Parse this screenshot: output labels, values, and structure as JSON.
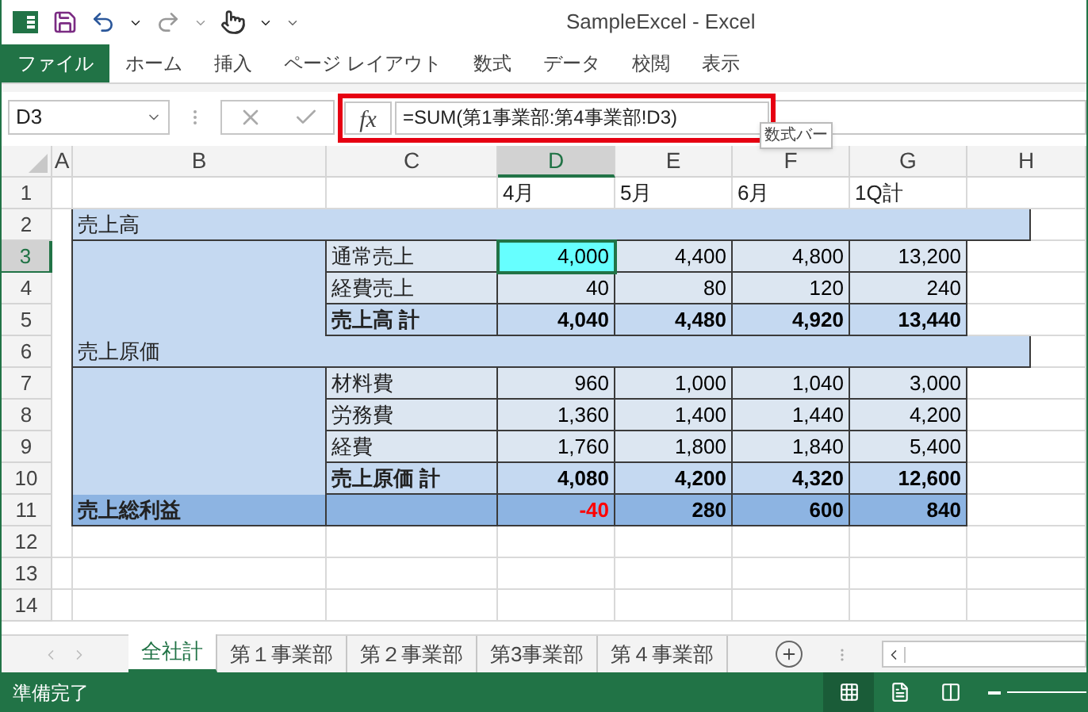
{
  "window": {
    "title": "SampleExcel - Excel"
  },
  "ribbon_tabs": [
    {
      "label": "ファイル",
      "kind": "file"
    },
    {
      "label": "ホーム",
      "kind": "tab"
    },
    {
      "label": "挿入",
      "kind": "tab"
    },
    {
      "label": "ページ レイアウト",
      "kind": "tab"
    },
    {
      "label": "数式",
      "kind": "tab"
    },
    {
      "label": "データ",
      "kind": "tab"
    },
    {
      "label": "校閲",
      "kind": "tab"
    },
    {
      "label": "表示",
      "kind": "tab"
    }
  ],
  "formula_bar": {
    "name_box": "D3",
    "fx": "fx",
    "formula": "=SUM(第1事業部:第4事業部!D3)",
    "tooltip": "数式バー"
  },
  "columns": [
    {
      "label": "A",
      "selected": false
    },
    {
      "label": "B",
      "selected": false
    },
    {
      "label": "C",
      "selected": false
    },
    {
      "label": "D",
      "selected": true
    },
    {
      "label": "E",
      "selected": false
    },
    {
      "label": "F",
      "selected": false
    },
    {
      "label": "G",
      "selected": false
    },
    {
      "label": "H",
      "selected": false
    }
  ],
  "rows": [
    {
      "number": "1",
      "selected": false,
      "kind": "header",
      "values": [
        "4月",
        "5月",
        "6月",
        "1Q計"
      ]
    },
    {
      "number": "2",
      "selected": false,
      "kind": "section",
      "label": "売上高"
    },
    {
      "number": "3",
      "selected": true,
      "kind": "item",
      "label": "通常売上",
      "values": [
        "4,000",
        "4,400",
        "4,800",
        "13,200"
      ]
    },
    {
      "number": "4",
      "selected": false,
      "kind": "item",
      "label": "経費売上",
      "values": [
        "40",
        "80",
        "120",
        "240"
      ]
    },
    {
      "number": "5",
      "selected": false,
      "kind": "subtotal",
      "label": "売上高 計",
      "values": [
        "4,040",
        "4,480",
        "4,920",
        "13,440"
      ]
    },
    {
      "number": "6",
      "selected": false,
      "kind": "section",
      "label": "売上原価"
    },
    {
      "number": "7",
      "selected": false,
      "kind": "item",
      "label": "材料費",
      "values": [
        "960",
        "1,000",
        "1,040",
        "3,000"
      ]
    },
    {
      "number": "8",
      "selected": false,
      "kind": "item",
      "label": "労務費",
      "values": [
        "1,360",
        "1,400",
        "1,440",
        "4,200"
      ]
    },
    {
      "number": "9",
      "selected": false,
      "kind": "item",
      "label": "経費",
      "values": [
        "1,760",
        "1,800",
        "1,840",
        "5,400"
      ]
    },
    {
      "number": "10",
      "selected": false,
      "kind": "subtotal",
      "label": "売上原価 計",
      "values": [
        "4,080",
        "4,200",
        "4,320",
        "12,600"
      ]
    },
    {
      "number": "11",
      "selected": false,
      "kind": "total",
      "label": "売上総利益",
      "values": [
        {
          "text": "-40",
          "negative": true
        },
        {
          "text": "280",
          "negative": false
        },
        {
          "text": "600",
          "negative": false
        },
        {
          "text": "840",
          "negative": false
        }
      ]
    },
    {
      "number": "12",
      "selected": false,
      "kind": "empty"
    },
    {
      "number": "13",
      "selected": false,
      "kind": "empty"
    },
    {
      "number": "14",
      "selected": false,
      "kind": "empty"
    }
  ],
  "sheet_tabs": [
    {
      "label": "全社計",
      "selected": true
    },
    {
      "label": "第１事業部",
      "selected": false
    },
    {
      "label": "第２事業部",
      "selected": false
    },
    {
      "label": "第3事業部",
      "selected": false
    },
    {
      "label": "第４事業部",
      "selected": false
    }
  ],
  "status_bar": {
    "text": "準備完了"
  }
}
